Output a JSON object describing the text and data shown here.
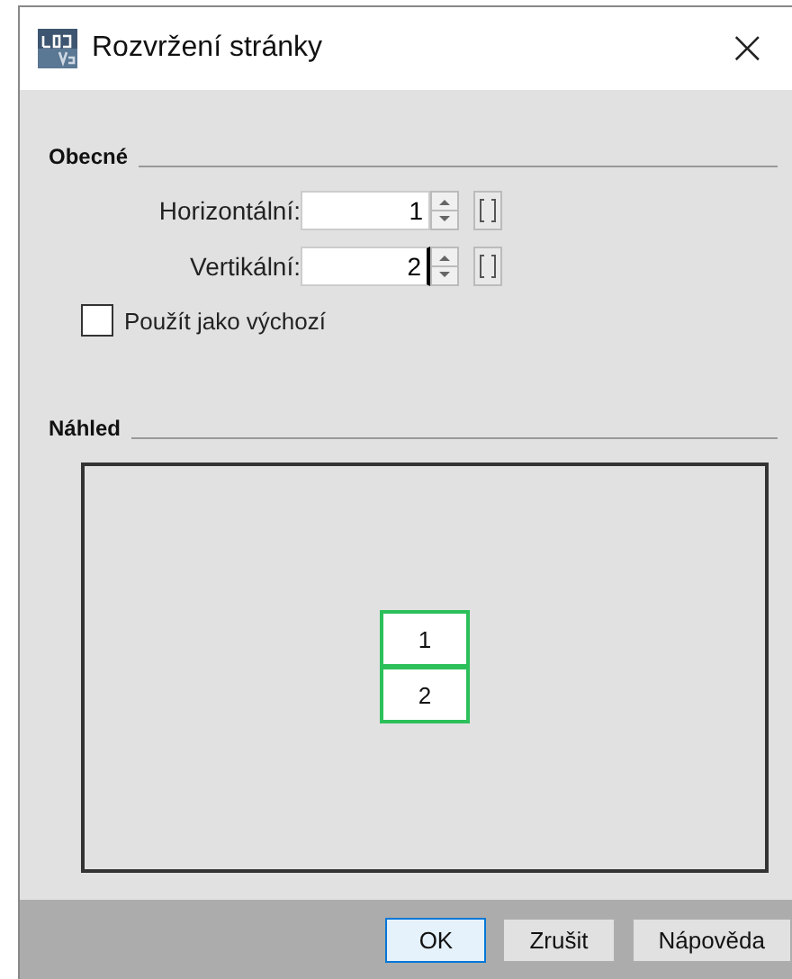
{
  "window": {
    "title": "Rozvržení stránky",
    "close": "×"
  },
  "general": {
    "title": "Obecné",
    "fields": [
      {
        "label": "Horizontální:",
        "value": "1",
        "focused": false
      },
      {
        "label": "Vertikální:",
        "value": "2",
        "focused": true
      }
    ],
    "checkbox": {
      "label": "Použít jako výchozí",
      "checked": false
    }
  },
  "preview": {
    "title": "Náhled",
    "pages": [
      "1",
      "2"
    ]
  },
  "buttons": [
    {
      "label": "OK",
      "default": true
    },
    {
      "label": "Zrušit",
      "default": false
    },
    {
      "label": "Nápověda",
      "default": false
    }
  ]
}
